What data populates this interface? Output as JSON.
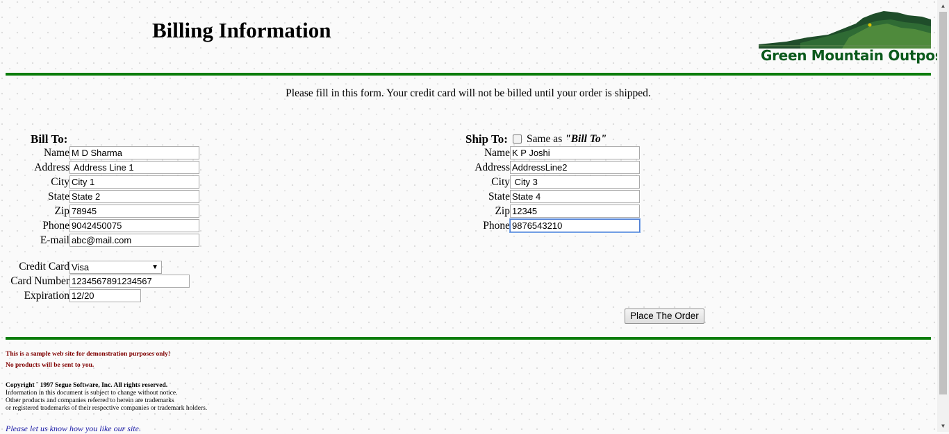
{
  "header": {
    "title": "Billing Information",
    "logo_text": "Green Mountain Outpost"
  },
  "intro_text": "Please fill in this form. Your credit card will not be billed until your order is shipped.",
  "bill_to": {
    "heading": "Bill To:",
    "fields": [
      {
        "label": "Name",
        "value": "M D Sharma"
      },
      {
        "label": "Address",
        "value": " Address Line 1"
      },
      {
        "label": "City",
        "value": "City 1"
      },
      {
        "label": "State",
        "value": "State 2"
      },
      {
        "label": "Zip",
        "value": "78945"
      },
      {
        "label": "Phone",
        "value": "9042450075"
      },
      {
        "label": "E-mail",
        "value": "abc@mail.com"
      }
    ]
  },
  "payment": {
    "credit_card_label": "Credit Card",
    "credit_card_value": "Visa",
    "card_number_label": "Card Number",
    "card_number_value": "1234567891234567",
    "expiration_label": "Expiration",
    "expiration_value": "12/20"
  },
  "ship_to": {
    "heading": "Ship To:",
    "same_as_prefix": "Same as ",
    "same_as_emph": "\"Bill To\"",
    "same_as_checked": false,
    "fields": [
      {
        "label": "Name",
        "value": "K P Joshi"
      },
      {
        "label": "Address",
        "value": "AddressLine2"
      },
      {
        "label": "City",
        "value": " City 3"
      },
      {
        "label": "State",
        "value": "State 4"
      },
      {
        "label": "Zip",
        "value": "12345"
      },
      {
        "label": "Phone",
        "value": "9876543210"
      }
    ]
  },
  "place_order_label": "Place The Order",
  "footer": {
    "notice_1": "This is a sample web site for demonstration purposes only!",
    "notice_2": "No products will be sent to you.",
    "copyright": "Copyright ¨ 1997 Segue Software, Inc. All rights reserved.",
    "line_1": "Information in this document is subject to change without notice.",
    "line_2": "Other products and companies referred to herein are trademarks",
    "line_3": "or registered trademarks of their respective companies or trademark holders.",
    "feedback_link": "Please let us know how you like our site."
  },
  "colors": {
    "rule_green": "#0a7d0a",
    "logo_green": "#0b5a1c",
    "notice_red": "#800000",
    "link_blue": "#1a1aa6"
  },
  "icons": {
    "dropdown": "chevron-down-icon",
    "scroll_up": "arrow-up-icon",
    "scroll_down": "arrow-down-icon"
  }
}
